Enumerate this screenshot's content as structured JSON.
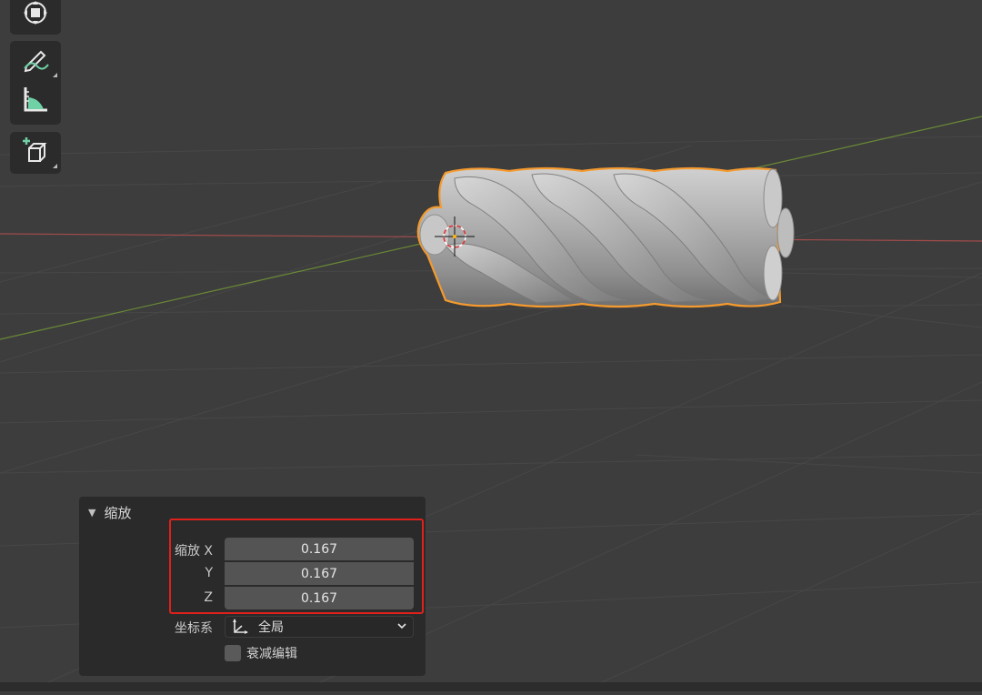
{
  "viewport": {
    "background": "#3d3d3d",
    "selection_outline_color": "#f59a2e",
    "axis_x_color": "#a24b4b",
    "axis_y_color": "#6a8a36"
  },
  "toolbar": {
    "tools": [
      {
        "name": "transform",
        "icon": "transform-icon"
      },
      {
        "name": "annotate",
        "icon": "annotate-pencil-icon"
      },
      {
        "name": "measure",
        "icon": "measure-ruler-icon"
      },
      {
        "name": "add-cube",
        "icon": "add-cube-icon"
      }
    ]
  },
  "operator_panel": {
    "title": "缩放",
    "scale_label": "缩放 X",
    "y_label": "Y",
    "z_label": "Z",
    "scale_x": "0.167",
    "scale_y": "0.167",
    "scale_z": "0.167",
    "orientation_label": "坐标系",
    "orientation_value": "全局",
    "proportional_label": "衰减编辑",
    "proportional_checked": false,
    "highlight_color": "#e0201b"
  }
}
